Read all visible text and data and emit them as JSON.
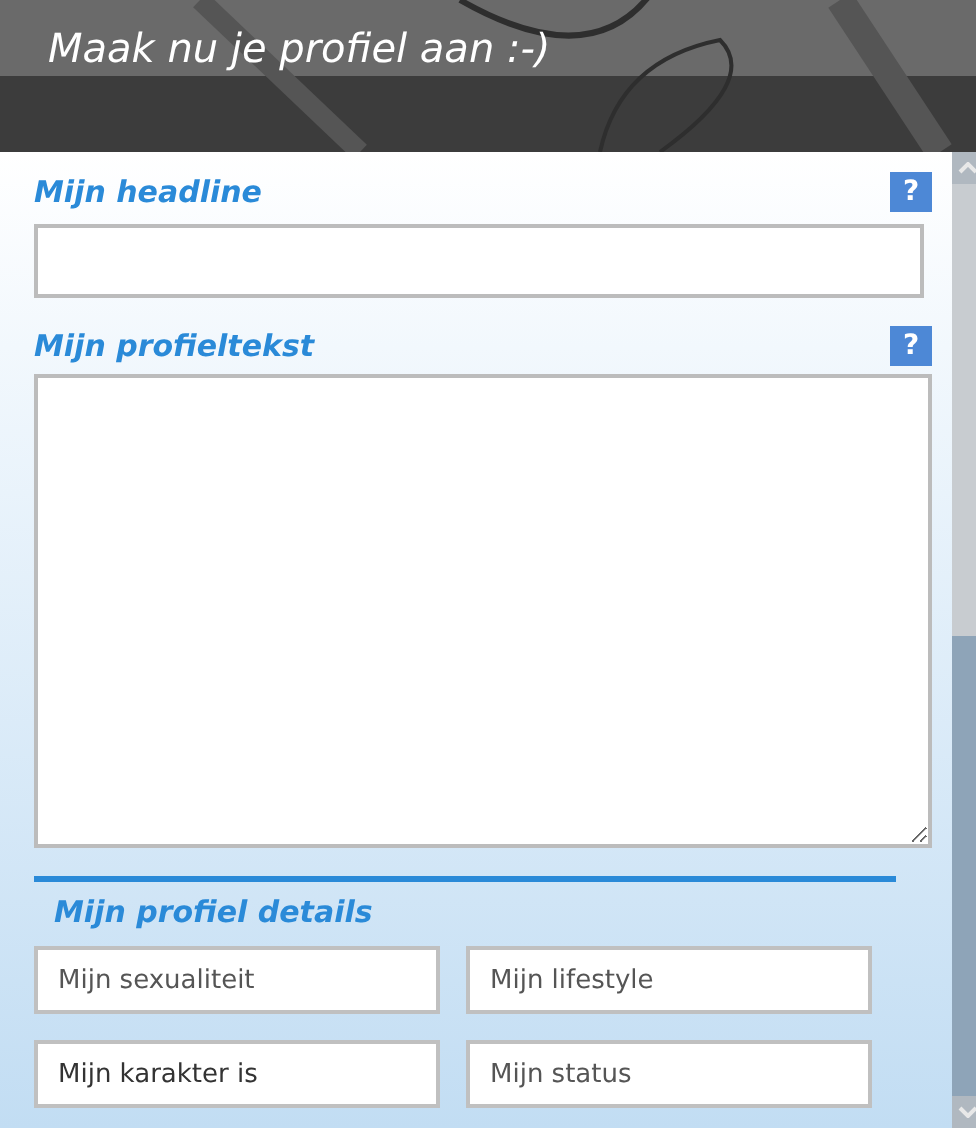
{
  "header": {
    "title": "Maak nu je profiel aan :-)"
  },
  "headline": {
    "label": "Mijn headline",
    "help": "?"
  },
  "profile_text": {
    "label": "Mijn profieltekst",
    "help": "?"
  },
  "details": {
    "title": "Mijn profiel details",
    "fields": [
      {
        "placeholder": "Mijn sexualiteit"
      },
      {
        "placeholder": "Mijn lifestyle"
      },
      {
        "value": "Mijn karakter is"
      },
      {
        "placeholder": "Mijn status"
      }
    ]
  }
}
